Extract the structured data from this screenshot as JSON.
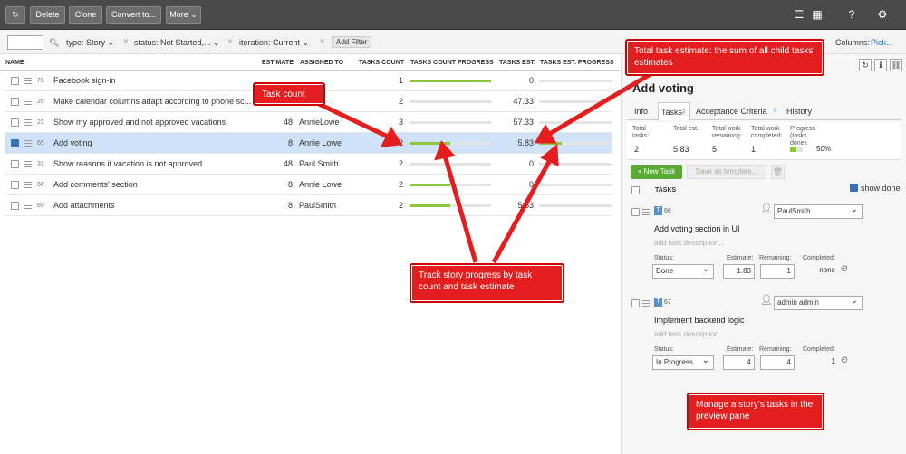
{
  "toolbar": {
    "delete": "Delete",
    "clone": "Clone",
    "convert": "Convert to...",
    "more": "More ⌄"
  },
  "filters": {
    "type": "type: Story ⌄",
    "status": "status: Not Started,... ⌄",
    "iteration": "iteration: Current ⌄",
    "add": "Add Filter",
    "columns_label": "Columns:",
    "columns_link": "Pick..."
  },
  "grid": {
    "headers": {
      "name": "NAME",
      "estimate": "ESTIMATE",
      "assigned": "ASSIGNED TO",
      "count": "TASKS COUNT",
      "count_progress": "TASKS COUNT PROGRESS",
      "est": "TASKS EST.",
      "est_progress": "TASKS EST. PROGRESS"
    },
    "rows": [
      {
        "id": "76",
        "name": "Facebook sign-in",
        "estimate": "",
        "assigned": "",
        "count": "1",
        "count_progress": 1.0,
        "tasks_est": "0",
        "est_progress": 0
      },
      {
        "id": "26",
        "name": "Make calendar columns adapt according to phone sc...",
        "estimate": "",
        "assigned": "admin",
        "count": "2",
        "count_progress": 0,
        "tasks_est": "47.33",
        "est_progress": 0
      },
      {
        "id": "21",
        "name": "Show my approved and not approved vacations",
        "estimate": "48",
        "assigned": "AnnieLowe",
        "count": "3",
        "count_progress": 0,
        "tasks_est": "57.33",
        "est_progress": 0
      },
      {
        "id": "65",
        "name": "Add voting",
        "estimate": "8",
        "assigned": "Annie Lowe",
        "count": "2",
        "count_progress": 0.5,
        "tasks_est": "5.83",
        "est_progress": 0.31
      },
      {
        "id": "31",
        "name": "Show reasons if vacation is not approved",
        "estimate": "48",
        "assigned": "Paul Smith",
        "count": "2",
        "count_progress": 0,
        "tasks_est": "0",
        "est_progress": 0
      },
      {
        "id": "60",
        "name": "Add comments' section",
        "estimate": "8",
        "assigned": "Annie Lowe",
        "count": "2",
        "count_progress": 0.5,
        "tasks_est": "0",
        "est_progress": 0
      },
      {
        "id": "69",
        "name": "Add attachments",
        "estimate": "8",
        "assigned": "PaulSmith",
        "count": "2",
        "count_progress": 0.5,
        "tasks_est": "5.83",
        "est_progress": 0
      }
    ]
  },
  "preview": {
    "title": "Add voting",
    "tabs": {
      "info": "Info",
      "tasks": "Tasks",
      "tasks_count": "2",
      "ac": "Acceptance Criteria",
      "ac_count": "0",
      "history": "History"
    },
    "stats": {
      "total_tasks_label": "Total tasks:",
      "total_tasks": "2",
      "total_est_label": "Total est.:",
      "total_est": "5.83",
      "remaining_label": "Total work remaining:",
      "remaining": "5",
      "completed_label": "Total work completed:",
      "completed": "1",
      "progress_label": "Progress (tasks done):",
      "progress": "50%",
      "progress_value": 0.5
    },
    "new_task": "+ New Task",
    "save_template": "Save as template...",
    "tasks_header": "TASKS",
    "show_done": "show done",
    "tasks": [
      {
        "id": "66",
        "assignee": "PaulSmith",
        "name": "Add voting section in UI",
        "desc": "add task description...",
        "status_label": "Status:",
        "status": "Done",
        "est_label": "Estimate:",
        "est": "1.83",
        "rem_label": "Remaining:",
        "rem": "1",
        "comp_label": "Completed:",
        "comp": "none"
      },
      {
        "id": "67",
        "assignee": "admin admin",
        "name": "Implement backend logic",
        "desc": "add task description...",
        "status_label": "Status:",
        "status": "In Progress",
        "est_label": "Estimate:",
        "est": "4",
        "rem_label": "Remaining:",
        "rem": "4",
        "comp_label": "Completed:",
        "comp": "1"
      }
    ]
  },
  "callouts": {
    "task_count": "Task count",
    "total_estimate": "Total task estimate: the sum of all child tasks' estimates",
    "track_progress": "Track story progress by task count and task estimate",
    "manage_tasks": "Manage a story's tasks in the preview pane"
  },
  "colors": {
    "accent_green": "#8dc63f",
    "callout_red": "#e41e1e",
    "toolbar": "#4a4a4a",
    "selected_row": "#cfe2f7"
  }
}
